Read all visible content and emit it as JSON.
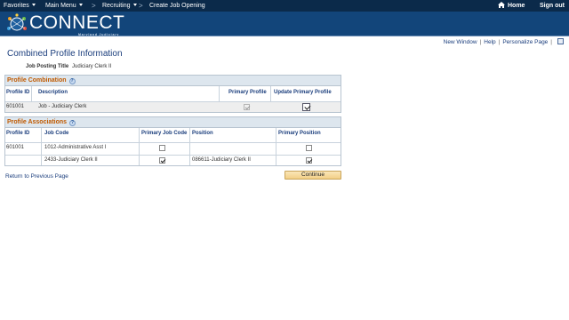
{
  "topnav": {
    "favorites": "Favorites",
    "main_menu": "Main Menu",
    "breadcrumb_sep": ">",
    "recruiting": "Recruiting",
    "job_opening": "Create Job Opening",
    "home": "Home",
    "sign_out": "Sign out"
  },
  "banner": {
    "logo_text": "CONNECT",
    "logo_sub": "Maryland Judiciary"
  },
  "page_links": {
    "new_window": "New Window",
    "help": "Help",
    "personalize": "Personalize Page",
    "separator": "|"
  },
  "page": {
    "title": "Combined Profile Information",
    "job_posting_label": "Job Posting Title",
    "job_posting_value": "Judiciary Clerk II"
  },
  "profile_combination": {
    "title": "Profile Combination",
    "columns": [
      "Profile ID",
      "Description",
      "Primary Profile",
      "Update Primary Profile"
    ],
    "rows": [
      {
        "profile_id": "601001",
        "description": "Job - Judiciary Clerk",
        "primary_profile": true,
        "update_primary_profile": true
      }
    ]
  },
  "profile_associations": {
    "title": "Profile Associations",
    "columns": [
      "Profile ID",
      "Job Code",
      "Primary Job Code",
      "Position",
      "Primary Position"
    ],
    "rows": [
      {
        "profile_id": "601001",
        "job_code": "1012-Administrative Asst I",
        "primary_job_code": false,
        "position": "",
        "primary_position": false
      },
      {
        "profile_id": "",
        "job_code": "2433-Judiciary Clerk II",
        "primary_job_code": true,
        "position": "086611-Judiciary Clerk II",
        "primary_position": true
      }
    ]
  },
  "actions": {
    "return_link": "Return to Previous Page",
    "continue": "Continue"
  },
  "colors": {
    "nav_bg": "#0b2a4a",
    "banner_bg": "#12457a",
    "link": "#1a3d7c",
    "group_title": "#c05a00",
    "group_header_bg": "#dde6ee"
  }
}
